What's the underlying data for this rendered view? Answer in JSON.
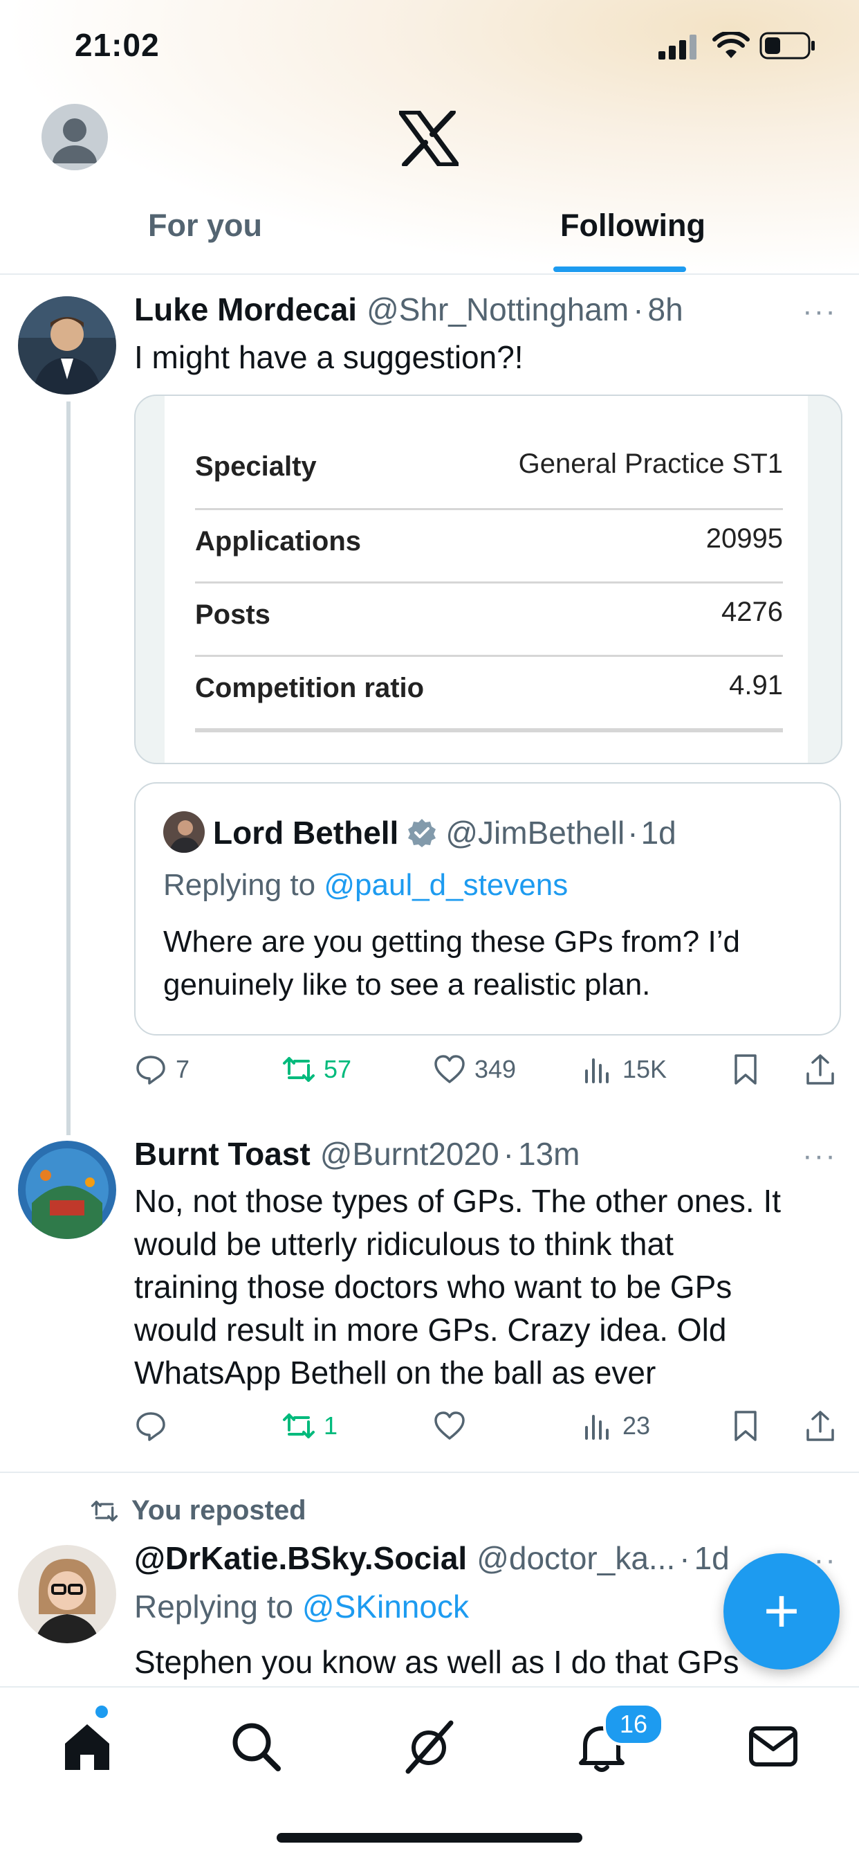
{
  "status_bar": {
    "time": "21:02",
    "icons": [
      "signal-icon",
      "wifi-icon",
      "battery-icon"
    ]
  },
  "header": {
    "logo": "x-logo",
    "tabs": [
      {
        "label": "For you",
        "active": false
      },
      {
        "label": "Following",
        "active": true
      }
    ]
  },
  "posts": [
    {
      "name": "Luke Mordecai",
      "handle": "@Shr_Nottingham",
      "sep": "·",
      "time": "8h",
      "text": "I might have a suggestion?!",
      "more": "···",
      "table": [
        {
          "label": "Specialty",
          "value": "General Practice ST1"
        },
        {
          "label": "Applications",
          "value": "20995"
        },
        {
          "label": "Posts",
          "value": "4276"
        },
        {
          "label": "Competition ratio",
          "value": "4.91"
        }
      ],
      "quote": {
        "name": "Lord Bethell",
        "handle": "@JimBethell",
        "sep": "·",
        "time": "1d",
        "replying_prefix": "Replying to ",
        "replying_to": "@paul_d_stevens",
        "text_line1": "Where are you getting these GPs from? I’d",
        "text_line2": "genuinely like to see a realistic plan."
      },
      "stats": {
        "replies": "7",
        "reposts": "57",
        "likes": "349",
        "views": "15K"
      }
    },
    {
      "name": "Burnt Toast",
      "handle": "@Burnt2020",
      "sep": "·",
      "time": "13m",
      "more": "···",
      "text_lines": [
        "No, not those types of GPs. The other ones. It",
        "would be utterly ridiculous to think that",
        "training those doctors who want to be GPs",
        "would result in more GPs. Crazy idea. Old",
        "WhatsApp Bethell on the ball as ever"
      ],
      "stats": {
        "replies": "",
        "reposts": "1",
        "likes": "",
        "views": "23"
      }
    },
    {
      "repost_label": "You reposted",
      "name": "@DrKatie.BSky.Social",
      "handle": "@doctor_ka...",
      "sep": "·",
      "time": "1d",
      "more": "···",
      "replying_prefix": "Replying to ",
      "replying_to": "@SKinnock",
      "text": "Stephen you know as well as I do that GPs"
    }
  ],
  "fab": {
    "label": "+"
  },
  "bottom_nav": {
    "notifications_badge": "16",
    "items": [
      "home-icon",
      "search-icon",
      "grok-icon",
      "notifications-icon",
      "messages-icon"
    ]
  },
  "colors": {
    "accent": "#1d9bf0",
    "repost_green": "#00ba7c",
    "secondary_text": "#536471"
  }
}
